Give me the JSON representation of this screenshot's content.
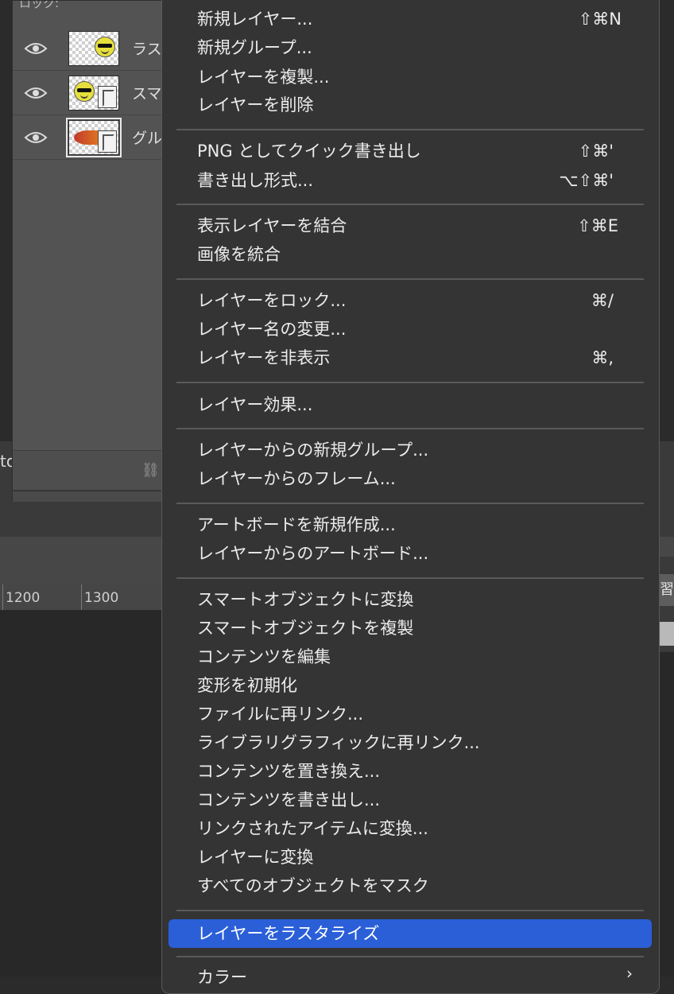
{
  "layers_panel": {
    "header_partial": "ロック:",
    "layers": [
      {
        "name": "ラス",
        "thumbnail": "smiley-raster",
        "visible": true,
        "selected": false
      },
      {
        "name": "スマ",
        "thumbnail": "smiley-smart-object",
        "visible": true,
        "selected": false
      },
      {
        "name": "グル",
        "thumbnail": "fish-smart-object",
        "visible": true,
        "selected": true
      }
    ]
  },
  "ruler": {
    "ticks": [
      "1200",
      "1300"
    ]
  },
  "left_fragment": "to",
  "right_fragment": "習",
  "context_menu": {
    "groups": [
      [
        {
          "label": "新規レイヤー...",
          "shortcut": "⇧⌘N"
        },
        {
          "label": "新規グループ...",
          "shortcut": ""
        },
        {
          "label": "レイヤーを複製...",
          "shortcut": ""
        },
        {
          "label": "レイヤーを削除",
          "shortcut": ""
        }
      ],
      [
        {
          "label": "PNG としてクイック書き出し",
          "shortcut": "⇧⌘'"
        },
        {
          "label": "書き出し形式...",
          "shortcut": "⌥⇧⌘'"
        }
      ],
      [
        {
          "label": "表示レイヤーを結合",
          "shortcut": "⇧⌘E"
        },
        {
          "label": "画像を統合",
          "shortcut": ""
        }
      ],
      [
        {
          "label": "レイヤーをロック...",
          "shortcut": "⌘/"
        },
        {
          "label": "レイヤー名の変更...",
          "shortcut": ""
        },
        {
          "label": "レイヤーを非表示",
          "shortcut": "⌘,"
        }
      ],
      [
        {
          "label": "レイヤー効果...",
          "shortcut": ""
        }
      ],
      [
        {
          "label": "レイヤーからの新規グループ...",
          "shortcut": ""
        },
        {
          "label": "レイヤーからのフレーム...",
          "shortcut": ""
        }
      ],
      [
        {
          "label": "アートボードを新規作成...",
          "shortcut": ""
        },
        {
          "label": "レイヤーからのアートボード...",
          "shortcut": ""
        }
      ],
      [
        {
          "label": "スマートオブジェクトに変換",
          "shortcut": ""
        },
        {
          "label": "スマートオブジェクトを複製",
          "shortcut": ""
        },
        {
          "label": "コンテンツを編集",
          "shortcut": ""
        },
        {
          "label": "変形を初期化",
          "shortcut": ""
        },
        {
          "label": "ファイルに再リンク...",
          "shortcut": ""
        },
        {
          "label": "ライブラリグラフィックに再リンク...",
          "shortcut": ""
        },
        {
          "label": "コンテンツを置き換え...",
          "shortcut": ""
        },
        {
          "label": "コンテンツを書き出し...",
          "shortcut": ""
        },
        {
          "label": "リンクされたアイテムに変換...",
          "shortcut": ""
        },
        {
          "label": "レイヤーに変換",
          "shortcut": ""
        },
        {
          "label": "すべてのオブジェクトをマスク",
          "shortcut": ""
        }
      ],
      [
        {
          "label": "レイヤーをラスタライズ",
          "shortcut": "",
          "highlighted": true
        }
      ],
      [
        {
          "label": "カラー",
          "shortcut": "",
          "submenu": true
        }
      ]
    ]
  },
  "colors": {
    "menu_bg": "#343434",
    "highlight": "#2a5fd8",
    "panel_bg": "#535353"
  }
}
